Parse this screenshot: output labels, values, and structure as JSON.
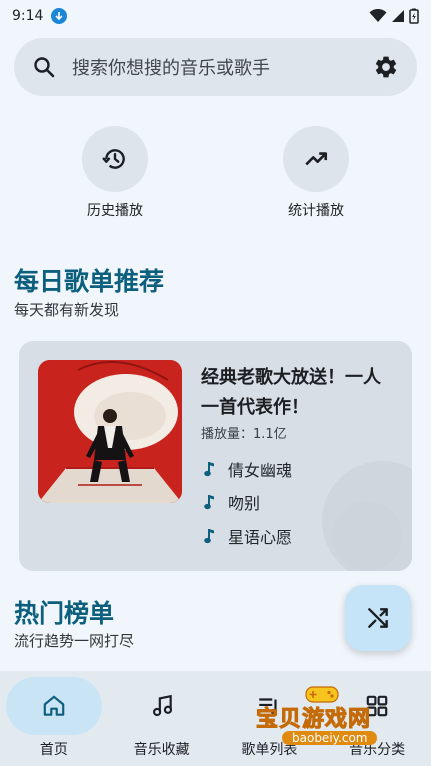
{
  "status_bar": {
    "time": "9:14"
  },
  "search": {
    "placeholder": "搜索你想搜的音乐或歌手"
  },
  "quick_actions": [
    {
      "label": "历史播放",
      "icon": "history-icon"
    },
    {
      "label": "统计播放",
      "icon": "trending-up-icon"
    }
  ],
  "daily": {
    "title": "每日歌单推荐",
    "subtitle": "每天都有新发现",
    "playlist": {
      "title": "经典老歌大放送！一人一首代表作！",
      "play_count": "播放量：1.1亿",
      "songs": [
        "倩女幽魂",
        "吻别",
        "星语心愿"
      ]
    }
  },
  "charts_section": {
    "title": "热门榜单",
    "subtitle": "流行趋势一网打尽"
  },
  "bottom_nav": {
    "items": [
      {
        "label": "首页",
        "icon": "home-icon",
        "active": true
      },
      {
        "label": "音乐收藏",
        "icon": "music-note-icon",
        "active": false
      },
      {
        "label": "歌单列表",
        "icon": "playlist-icon",
        "active": false
      },
      {
        "label": "音乐分类",
        "icon": "category-icon",
        "active": false
      }
    ]
  },
  "watermark": {
    "text": "宝贝游戏网",
    "url": "baobeiy.com"
  },
  "colors": {
    "accent": "#0d5f7e",
    "background": "#f0f6fb",
    "active_pill": "#c9e4f5",
    "fab": "#c5e4f7"
  }
}
